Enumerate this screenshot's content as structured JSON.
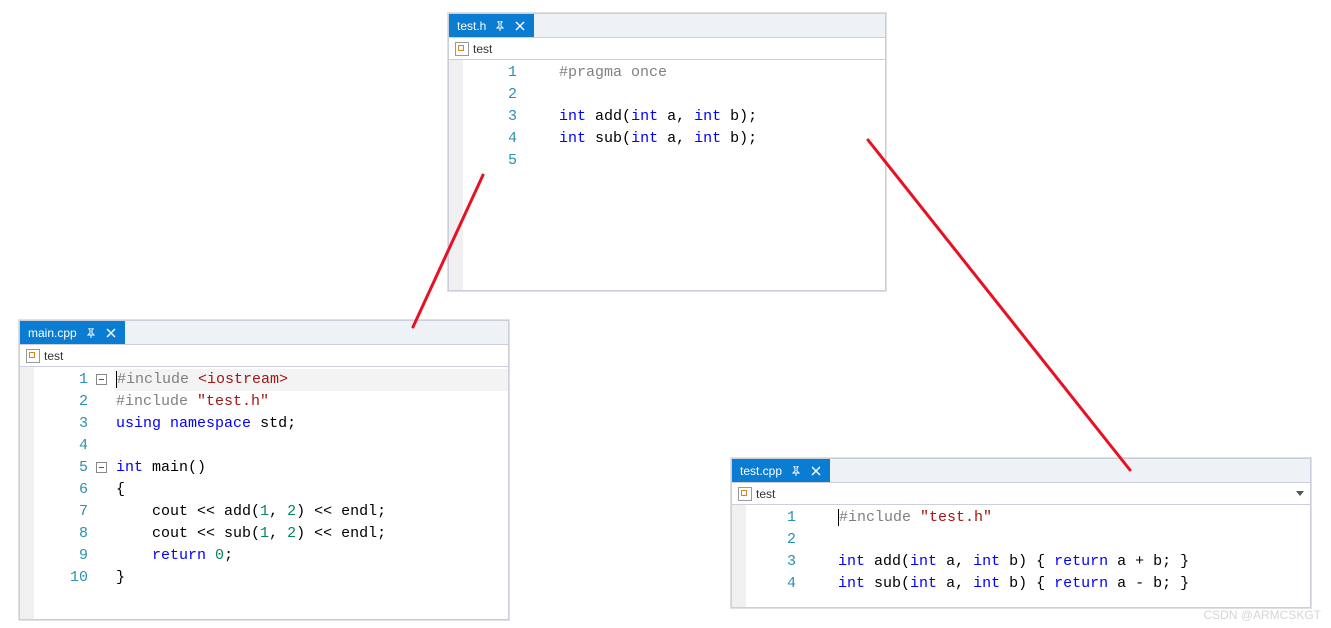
{
  "watermark": "CSDN @ARMCSKGT",
  "windows": {
    "testh": {
      "tab": "test.h",
      "context": "test",
      "lines": [
        "1",
        "2",
        "3",
        "4",
        "5"
      ],
      "code": {
        "l1": {
          "pre": "#pragma once"
        },
        "l3_int": "int",
        "l3_add": "add",
        "l3_params": "(",
        "l3_int2": "int",
        "l3_a": "a, ",
        "l3_int3": "int",
        "l3_b": "b);",
        "l4_int": "int",
        "l4_sub": "sub",
        "l4_params": "(",
        "l4_int2": "int",
        "l4_a": "a, ",
        "l4_int3": "int",
        "l4_b": "b);"
      }
    },
    "main": {
      "tab": "main.cpp",
      "context": "test",
      "lines": [
        "1",
        "2",
        "3",
        "4",
        "5",
        "6",
        "7",
        "8",
        "9",
        "10"
      ],
      "code": {
        "inc": "#include ",
        "ios": "<iostream>",
        "inc2": "#include ",
        "th": "\"test.h\"",
        "using": "using",
        "ns": "namespace",
        "std": "std;",
        "int": "int",
        "main": "main()",
        "ob": "{",
        "cout": "cout",
        "lt1": " << add(",
        "a1": "1",
        "c1": ", ",
        "a2": "2",
        "rt1": ") << endl;",
        "lt2": " << sub(",
        "rt2": ") << endl;",
        "ret": "return",
        "zero": "0",
        "semi": ";",
        "cb": "}"
      }
    },
    "testcpp": {
      "tab": "test.cpp",
      "context": "test",
      "lines": [
        "1",
        "2",
        "3",
        "4"
      ],
      "code": {
        "inc": "#include ",
        "th": "\"test.h\"",
        "l3_int": "int",
        "l3_add": "add(",
        "l3_int2": "int",
        "l3_a": " a, ",
        "l3_int3": "int",
        "l3_b": " b) { ",
        "l3_ret": "return",
        "l3_expr": " a + b; }",
        "l4_int": "int",
        "l4_sub": "sub(",
        "l4_int2": "int",
        "l4_a": " a, ",
        "l4_int3": "int",
        "l4_b": " b) { ",
        "l4_ret": "return",
        "l4_expr": " a - b; }"
      }
    }
  }
}
